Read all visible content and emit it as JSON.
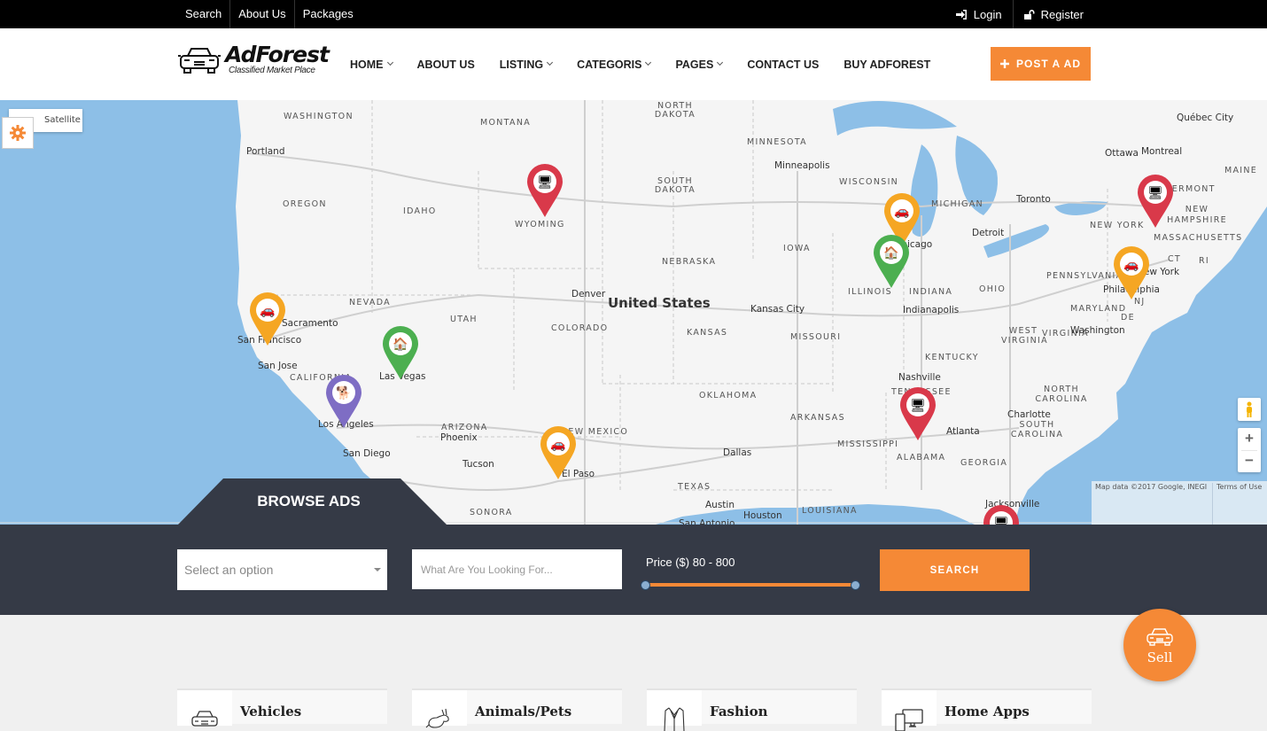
{
  "topbar": {
    "links": [
      "Search",
      "About Us",
      "Packages"
    ],
    "login": "Login",
    "register": "Register"
  },
  "header": {
    "logo_brand": "AdForest",
    "logo_tagline": "Classified Market Place",
    "nav": [
      {
        "label": "HOME",
        "dropdown": true
      },
      {
        "label": "ABOUT US",
        "dropdown": false
      },
      {
        "label": "LISTING",
        "dropdown": true
      },
      {
        "label": "CATEGORIS",
        "dropdown": true
      },
      {
        "label": "PAGES",
        "dropdown": true
      },
      {
        "label": "CONTACT US",
        "dropdown": false
      },
      {
        "label": "BUY ADFOREST",
        "dropdown": false
      }
    ],
    "post_ad_label": "POST A AD"
  },
  "map": {
    "type_button": "Satellite",
    "country_label": "United States",
    "attribution": "Map data ©2017 Google, INEGI",
    "terms": "Terms of Use",
    "zoom_in": "+",
    "zoom_out": "−",
    "state_labels": [
      "WASHINGTON",
      "MONTANA",
      "NORTH DAKOTA",
      "MINNESOTA",
      "OREGON",
      "IDAHO",
      "SOUTH DAKOTA",
      "WYOMING",
      "WISCONSIN",
      "MICHIGAN",
      "IOWA",
      "NEBRASKA",
      "NEVADA",
      "UTAH",
      "COLORADO",
      "KANSAS",
      "MISSOURI",
      "ILLINOIS",
      "INDIANA",
      "OHIO",
      "PENNSYLVANIA",
      "NEW YORK",
      "MAINE",
      "VERMONT",
      "NEW HAMPSHIRE",
      "MASSACHUSETTS",
      "CT",
      "RI",
      "NJ",
      "DE",
      "MARYLAND",
      "WEST VIRGINIA",
      "VIRGINIA",
      "KENTUCKY",
      "TENNESSEE",
      "NORTH CAROLINA",
      "SOUTH CAROLINA",
      "CALIFORNIA",
      "ARIZONA",
      "NEW MEXICO",
      "OKLAHOMA",
      "ARKANSAS",
      "TEXAS",
      "MISSISSIPPI",
      "ALABAMA",
      "GEORGIA",
      "LOUISIANA",
      "SONORA"
    ],
    "city_labels": [
      "Portland",
      "Minneapolis",
      "Québec City",
      "Ottawa",
      "Montreal",
      "Toronto",
      "Detroit",
      "Chicago",
      "Sacramento",
      "San Francisco",
      "San Jose",
      "Los Angeles",
      "San Diego",
      "Las Vegas",
      "Denver",
      "Kansas City",
      "Indianapolis",
      "Philadelphia",
      "New York",
      "Washington",
      "Nashville",
      "Charlotte",
      "Atlanta",
      "Phoenix",
      "Tucson",
      "El Paso",
      "Dallas",
      "Austin",
      "Houston",
      "San Antonio",
      "Jacksonville"
    ],
    "markers": [
      {
        "category": "electronics",
        "color": "#d9394a",
        "near": "Wyoming"
      },
      {
        "category": "vehicles",
        "color": "#f5a623",
        "near": "Sacramento"
      },
      {
        "category": "real-estate",
        "color": "#4caf50",
        "near": "Las Vegas"
      },
      {
        "category": "animals",
        "color": "#7e6dc4",
        "near": "Los Angeles"
      },
      {
        "category": "vehicles",
        "color": "#f5a623",
        "near": "El Paso"
      },
      {
        "category": "vehicles",
        "color": "#f5a623",
        "near": "Chicago"
      },
      {
        "category": "real-estate",
        "color": "#4caf50",
        "near": "Chicago"
      },
      {
        "category": "electronics",
        "color": "#d9394a",
        "near": "Massachusetts"
      },
      {
        "category": "vehicles",
        "color": "#f5a623",
        "near": "Philadelphia"
      },
      {
        "category": "electronics",
        "color": "#d9394a",
        "near": "Alabama"
      },
      {
        "category": "electronics",
        "color": "#d9394a",
        "near": "Jacksonville"
      }
    ]
  },
  "browse": {
    "tab_label": "BROWSE ADS",
    "category_select": "Select an option",
    "keyword_placeholder": "What Are You Looking For...",
    "keyword_value": "",
    "price_label": "Price ($) 80 - 800",
    "price_min": 80,
    "price_max": 800,
    "search_label": "SEARCH"
  },
  "sell_fab": {
    "label": "Sell"
  },
  "categories": [
    {
      "name": "Vehicles",
      "icon": "car-icon"
    },
    {
      "name": "Animals/Pets",
      "icon": "rabbit-icon"
    },
    {
      "name": "Fashion",
      "icon": "jacket-icon"
    },
    {
      "name": "Home Apps",
      "icon": "devices-icon"
    }
  ],
  "colors": {
    "accent": "#f58936",
    "dark_band": "#353a46",
    "water": "#8dbfe7",
    "marker_red": "#d9394a",
    "marker_orange": "#f5a623",
    "marker_green": "#4caf50",
    "marker_purple": "#7e6dc4"
  }
}
